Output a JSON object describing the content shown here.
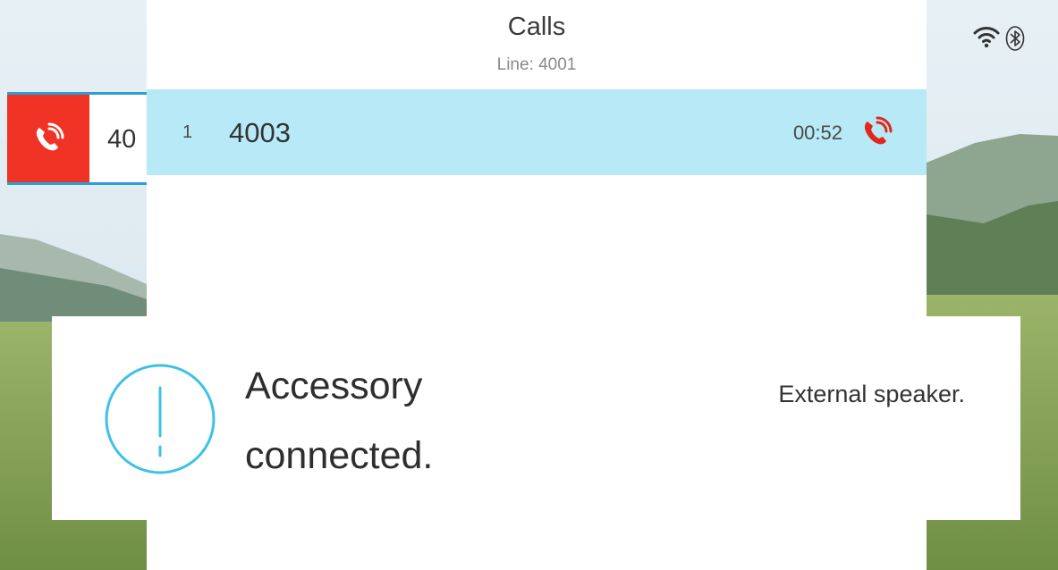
{
  "header": {
    "title": "Calls",
    "line": "Line: 4001"
  },
  "active_call": {
    "index": "1",
    "number": "4003",
    "duration": "00:52",
    "icon": "phone-active-icon",
    "icon_color": "#e3261b"
  },
  "side_session": {
    "number": "40",
    "icon": "phone-active-icon",
    "tab_color": "#f03325"
  },
  "status_bar": {
    "icons": [
      "wifi-icon",
      "bluetooth-icon"
    ]
  },
  "notification": {
    "icon": "alert-circle-icon",
    "title_line1": "Accessory",
    "title_line2": "connected.",
    "detail": "External speaker.",
    "accent_color": "#3fc1e6"
  },
  "colors": {
    "call_row_bg": "#b7e9f6",
    "tab_border": "#2a9fd6"
  }
}
